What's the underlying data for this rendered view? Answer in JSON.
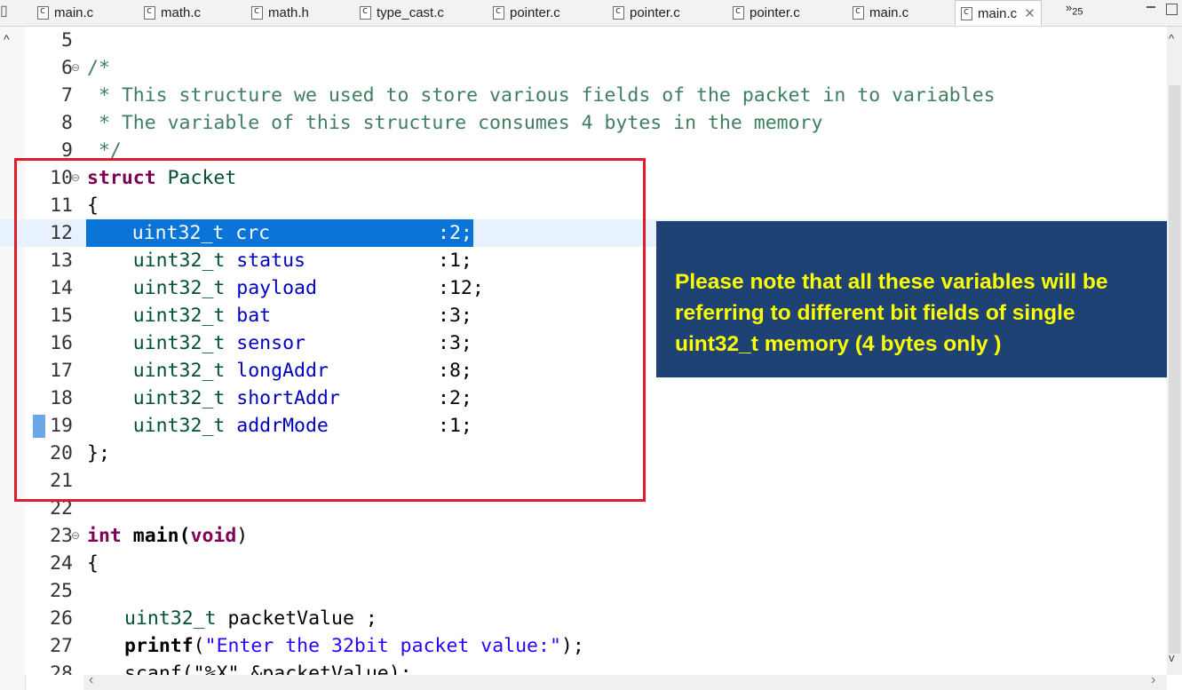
{
  "tabs": [
    {
      "label": "main.c"
    },
    {
      "label": "math.c"
    },
    {
      "label": "math.h"
    },
    {
      "label": "type_cast.c"
    },
    {
      "label": "pointer.c"
    },
    {
      "label": "pointer.c"
    },
    {
      "label": "pointer.c"
    },
    {
      "label": "main.c"
    },
    {
      "label": "main.c",
      "active": true
    }
  ],
  "tab_overflow": {
    "glyph": "»",
    "count": "25"
  },
  "editor": {
    "lines": [
      {
        "n": "5"
      },
      {
        "n": "6"
      },
      {
        "n": "7"
      },
      {
        "n": "8"
      },
      {
        "n": "9"
      },
      {
        "n": "10"
      },
      {
        "n": "11"
      },
      {
        "n": "12"
      },
      {
        "n": "13"
      },
      {
        "n": "14"
      },
      {
        "n": "15"
      },
      {
        "n": "16"
      },
      {
        "n": "17"
      },
      {
        "n": "18"
      },
      {
        "n": "19"
      },
      {
        "n": "20"
      },
      {
        "n": "21"
      },
      {
        "n": "22"
      },
      {
        "n": "23"
      },
      {
        "n": "24"
      },
      {
        "n": "25"
      },
      {
        "n": "26"
      },
      {
        "n": "27"
      },
      {
        "n": "28"
      }
    ],
    "code": {
      "c6": "/*",
      "c7": " * This structure we used to store various fields of the packet in to variables",
      "c8": " * The variable of this structure consumes 4 bytes in the memory",
      "c9": " */",
      "kw_struct": "struct",
      "struct_name": " Packet",
      "brace_open": "{",
      "brace_close": "};",
      "fields": [
        {
          "type": "uint32_t",
          "name": "crc",
          "bits": ":2;"
        },
        {
          "type": "uint32_t",
          "name": "status",
          "bits": ":1;"
        },
        {
          "type": "uint32_t",
          "name": "payload",
          "bits": ":12;"
        },
        {
          "type": "uint32_t",
          "name": "bat",
          "bits": ":3;"
        },
        {
          "type": "uint32_t",
          "name": "sensor",
          "bits": ":3;"
        },
        {
          "type": "uint32_t",
          "name": "longAddr",
          "bits": ":8;"
        },
        {
          "type": "uint32_t",
          "name": "shortAddr",
          "bits": ":2;"
        },
        {
          "type": "uint32_t",
          "name": "addrMode",
          "bits": ":1;"
        }
      ],
      "kw_int": "int",
      "fn_main": " main(",
      "kw_void": "void",
      "fn_close": ")",
      "main_brace": " {",
      "l26_type": "uint32_t",
      "l26_rest": " packetValue ;",
      "l27_fn": "printf",
      "l27_open": "(",
      "l27_str": "\"Enter the 32bit packet value:\"",
      "l27_close": ");",
      "l28_partial": "scanf(\"%X\",&packetValue);"
    }
  },
  "note": {
    "text": "Please note that all these variables will be referring to different bit fields of single uint32_t memory (4 bytes only )",
    "bg": "#1e4273",
    "fg": "#ffff00"
  },
  "highlight_color": "#e01b2a"
}
